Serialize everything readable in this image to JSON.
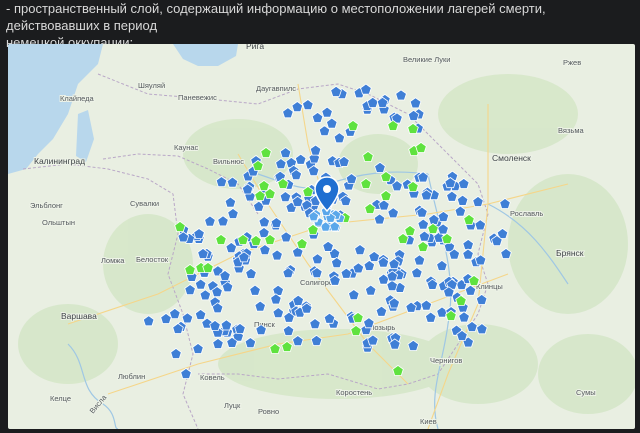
{
  "caption": {
    "line1": "- пространственный слой, содержащий информацию о местоположении лагерей смерти, действовавших в период",
    "line2": "немецкой оккупации;"
  },
  "colors": {
    "page_bg": "#1b1c1e",
    "land": "#e9efe2",
    "forest": "#d6e7c9",
    "water": "#b8d7ec",
    "marker_blue": "#3f7fd6",
    "marker_green": "#5fe23f",
    "pin": "#1f6fd1"
  },
  "map": {
    "selected_marker": "map-pin",
    "cities": [
      {
        "name": "Рига",
        "id": "riga"
      },
      {
        "name": "Шяуляй",
        "id": "shiaulyai"
      },
      {
        "name": "Даугавпилс",
        "id": "daugavpils"
      },
      {
        "name": "Великие Луки",
        "id": "velikie-luki"
      },
      {
        "name": "Ржев",
        "id": "rzhev"
      },
      {
        "name": "Клайпеда",
        "id": "klaipeda"
      },
      {
        "name": "Паневежис",
        "id": "panevezhis"
      },
      {
        "name": "Вязьма",
        "id": "vyazma"
      },
      {
        "name": "Калининград",
        "id": "kaliningrad"
      },
      {
        "name": "Каунас",
        "id": "kaunas"
      },
      {
        "name": "Вильнюс",
        "id": "vilnius"
      },
      {
        "name": "Смоленск",
        "id": "smolensk"
      },
      {
        "name": "Эльблонг",
        "id": "elblong"
      },
      {
        "name": "Сувалки",
        "id": "suvalki"
      },
      {
        "name": "Ольштын",
        "id": "olshtyn"
      },
      {
        "name": "Рославль",
        "id": "roslavl"
      },
      {
        "name": "Ломжа",
        "id": "lomzha"
      },
      {
        "name": "Белосток",
        "id": "belostok"
      },
      {
        "name": "Брянск",
        "id": "bryansk"
      },
      {
        "name": "Солигорск",
        "id": "soligorsk"
      },
      {
        "name": "Клинцы",
        "id": "klintsy"
      },
      {
        "name": "Варшава",
        "id": "varshava"
      },
      {
        "name": "Пинск",
        "id": "pinsk"
      },
      {
        "name": "Мозырь",
        "id": "mozyr"
      },
      {
        "name": "Чернигов",
        "id": "chernigov"
      },
      {
        "name": "Люблин",
        "id": "lyublin"
      },
      {
        "name": "Ковель",
        "id": "kovel"
      },
      {
        "name": "Коростень",
        "id": "korosten"
      },
      {
        "name": "Сумы",
        "id": "sumy"
      },
      {
        "name": "Келце",
        "id": "keltse"
      },
      {
        "name": "Луцк",
        "id": "lutsk"
      },
      {
        "name": "Ровно",
        "id": "rovno"
      },
      {
        "name": "Киев",
        "id": "kiev"
      },
      {
        "name": "Висла",
        "id": "visla"
      }
    ]
  }
}
